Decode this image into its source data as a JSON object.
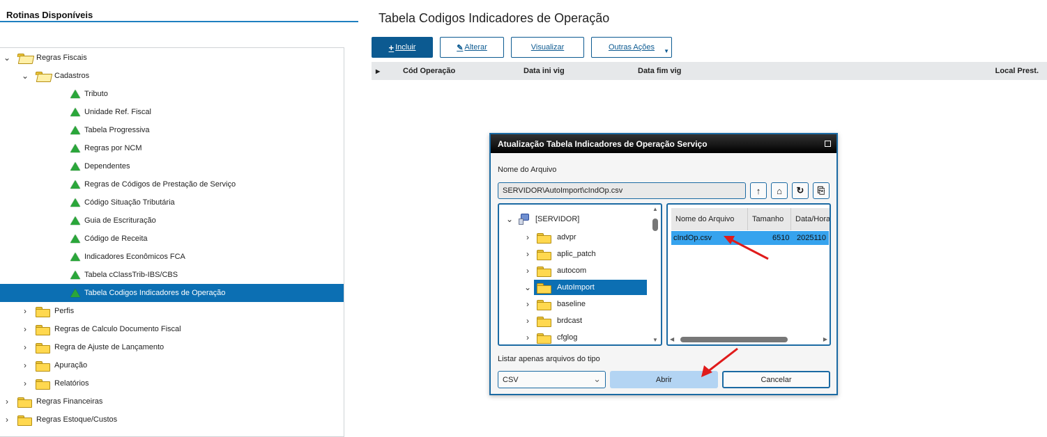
{
  "left_panel": {
    "title": "Rotinas Disponíveis",
    "tree": [
      {
        "label": "Regras Fiscais",
        "chev": "⌄",
        "icon": "folder-open-icon"
      },
      {
        "label": "Cadastros",
        "chev": "⌄",
        "icon": "folder-open-icon"
      },
      {
        "label": "Tributo",
        "icon": "routine-triangle-icon"
      },
      {
        "label": "Unidade Ref. Fiscal",
        "icon": "routine-triangle-icon"
      },
      {
        "label": "Tabela Progressiva",
        "icon": "routine-triangle-icon"
      },
      {
        "label": "Regras por NCM",
        "icon": "routine-triangle-icon"
      },
      {
        "label": "Dependentes",
        "icon": "routine-triangle-icon"
      },
      {
        "label": "Regras de Códigos de Prestação de Serviço",
        "icon": "routine-triangle-icon"
      },
      {
        "label": "Código Situação Tributária",
        "icon": "routine-triangle-icon"
      },
      {
        "label": "Guia de Escrituração",
        "icon": "routine-triangle-icon"
      },
      {
        "label": "Código de Receita",
        "icon": "routine-triangle-icon"
      },
      {
        "label": "Indicadores Econômicos FCA",
        "icon": "routine-triangle-icon"
      },
      {
        "label": "Tabela cClassTrib-IBS/CBS",
        "icon": "routine-triangle-icon"
      },
      {
        "label": "Tabela Codigos Indicadores de Operação",
        "icon": "routine-triangle-icon",
        "selected": true
      },
      {
        "label": "Perfis",
        "chev": "›",
        "icon": "folder-icon"
      },
      {
        "label": "Regras de Calculo Documento Fiscal",
        "chev": "›",
        "icon": "folder-icon"
      },
      {
        "label": "Regra de Ajuste de Lançamento",
        "chev": "›",
        "icon": "folder-icon"
      },
      {
        "label": "Apuração",
        "chev": "›",
        "icon": "folder-icon"
      },
      {
        "label": "Relatórios",
        "chev": "›",
        "icon": "folder-icon"
      },
      {
        "label": "Regras Financeiras",
        "chev": "›",
        "icon": "folder-icon"
      },
      {
        "label": "Regras Estoque/Custos",
        "chev": "›",
        "icon": "folder-icon"
      }
    ]
  },
  "main": {
    "title": "Tabela Codigos Indicadores de Operação",
    "toolbar": {
      "incluir": "Incluir",
      "alterar": "Alterar",
      "visualizar": "Visualizar",
      "outras": "Outras Ações"
    },
    "grid_columns": [
      "Cód Operação",
      "Data ini vig",
      "Data fim vig",
      "Local Prest."
    ]
  },
  "dialog": {
    "title": "Atualização Tabela Indicadores de Operação Serviço",
    "file_name_label": "Nome do Arquivo",
    "path_value": "SERVIDOR\\AutoImport\\cIndOp.csv",
    "folder_tree": {
      "root": "[SERVIDOR]",
      "folders": [
        {
          "name": "advpr"
        },
        {
          "name": "aplic_patch"
        },
        {
          "name": "autocom"
        },
        {
          "name": "AutoImport",
          "selected": true,
          "expanded": true
        },
        {
          "name": "baseline"
        },
        {
          "name": "brdcast"
        },
        {
          "name": "cfglog"
        }
      ]
    },
    "file_list": {
      "headers": [
        "Nome do Arquivo",
        "Tamanho",
        "Data/Hora"
      ],
      "rows": [
        {
          "name": "cIndOp.csv",
          "size": "6510",
          "date": "2025110"
        }
      ]
    },
    "filter_label": "Listar apenas arquivos do tipo",
    "filter_value": "CSV",
    "open_button": "Abrir",
    "cancel_button": "Cancelar"
  },
  "colors": {
    "accent": "#0c5a91",
    "selection": "#0c6fb3",
    "annotation_arrow": "#e01b1b",
    "routine_icon": "#2aa63a"
  }
}
